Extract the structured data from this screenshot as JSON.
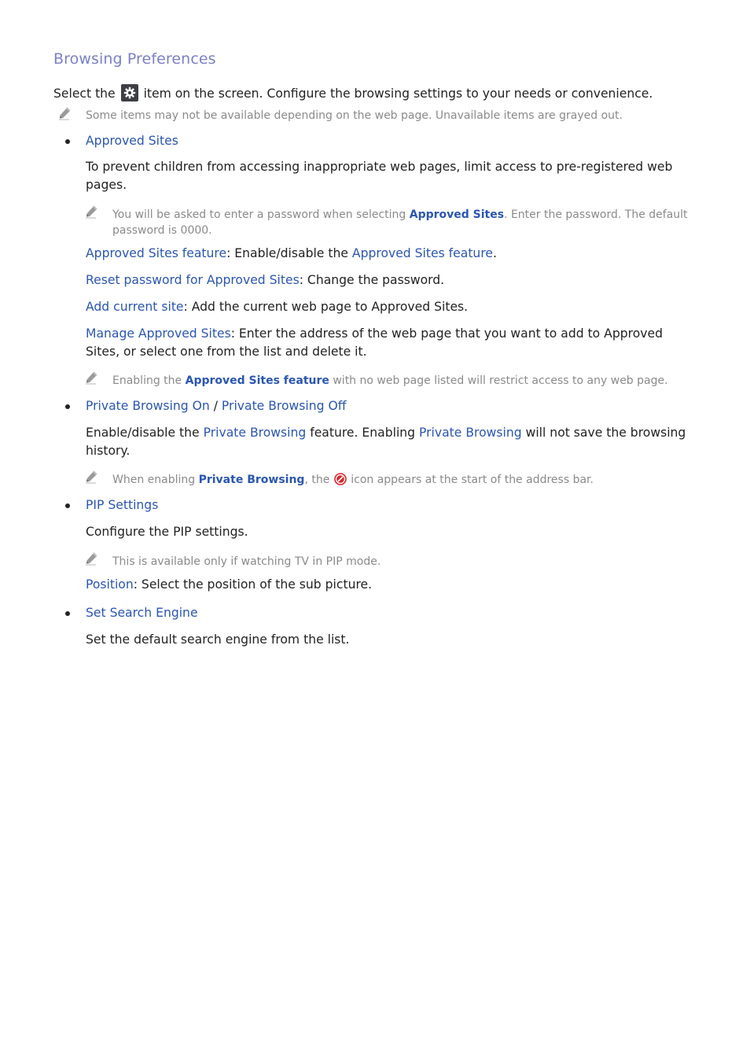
{
  "heading": "Browsing Preferences",
  "intro": {
    "before_icon": "Select the ",
    "icon": "gear-icon",
    "after_icon": " item on the screen. Configure the browsing settings to your needs or convenience."
  },
  "intro_note": "Some items may not be available depending on the web page. Unavailable items are grayed out.",
  "colors": {
    "heading": "#7B80C6",
    "link": "#2A56B0",
    "body": "#222222",
    "note": "#8a8a8a"
  },
  "sections": [
    {
      "title": "Approved Sites",
      "description": "To prevent children from accessing inappropriate web pages, limit access to pre-registered web pages.",
      "note": {
        "before": "You will be asked to enter a password when selecting ",
        "link": "Approved Sites",
        "after": ". Enter the password. The default password is 0000."
      },
      "options": [
        {
          "term": "Approved Sites feature",
          "text_before": ": Enable/disable the ",
          "link": "Approved Sites feature",
          "text_after": "."
        },
        {
          "term": "Reset password for Approved Sites",
          "text": ": Change the password."
        },
        {
          "term": "Add current site",
          "text": ": Add the current web page to Approved Sites."
        },
        {
          "term": "Manage Approved Sites",
          "text": ": Enter the address of the web page that you want to add to Approved Sites, or select one from the list and delete it."
        }
      ],
      "note2": {
        "before": "Enabling the ",
        "link": "Approved Sites feature",
        "after": " with no web page listed will restrict access to any web page."
      }
    },
    {
      "title_a": "Private Browsing On",
      "separator": " / ",
      "title_b": "Private Browsing Off",
      "description": {
        "p1": "Enable/disable the ",
        "link1": "Private Browsing",
        "p2": " feature. Enabling ",
        "link2": "Private Browsing",
        "p3": " will not save the browsing history."
      },
      "note": {
        "before": "When enabling ",
        "link": "Private Browsing",
        "middle": ", the ",
        "icon": "private-browsing-icon",
        "after": " icon appears at the start of the address bar."
      }
    },
    {
      "title": "PIP Settings",
      "description": "Configure the PIP settings.",
      "note": "This is available only if watching TV in PIP mode.",
      "options": [
        {
          "term": "Position",
          "text": ": Select the position of the sub picture."
        }
      ]
    },
    {
      "title": "Set Search Engine",
      "description": "Set the default search engine from the list."
    }
  ]
}
